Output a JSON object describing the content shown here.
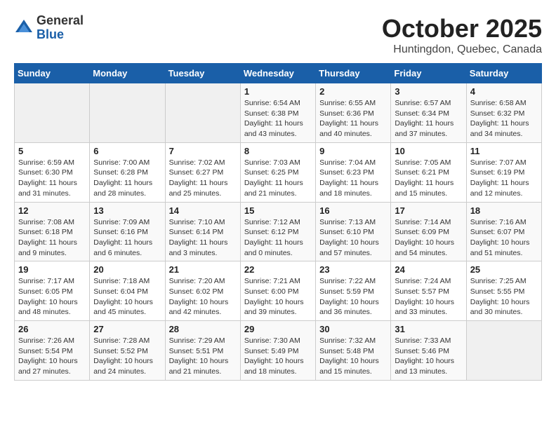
{
  "logo": {
    "general": "General",
    "blue": "Blue"
  },
  "title": "October 2025",
  "location": "Huntingdon, Quebec, Canada",
  "weekdays": [
    "Sunday",
    "Monday",
    "Tuesday",
    "Wednesday",
    "Thursday",
    "Friday",
    "Saturday"
  ],
  "weeks": [
    [
      {
        "day": "",
        "info": ""
      },
      {
        "day": "",
        "info": ""
      },
      {
        "day": "",
        "info": ""
      },
      {
        "day": "1",
        "info": "Sunrise: 6:54 AM\nSunset: 6:38 PM\nDaylight: 11 hours\nand 43 minutes."
      },
      {
        "day": "2",
        "info": "Sunrise: 6:55 AM\nSunset: 6:36 PM\nDaylight: 11 hours\nand 40 minutes."
      },
      {
        "day": "3",
        "info": "Sunrise: 6:57 AM\nSunset: 6:34 PM\nDaylight: 11 hours\nand 37 minutes."
      },
      {
        "day": "4",
        "info": "Sunrise: 6:58 AM\nSunset: 6:32 PM\nDaylight: 11 hours\nand 34 minutes."
      }
    ],
    [
      {
        "day": "5",
        "info": "Sunrise: 6:59 AM\nSunset: 6:30 PM\nDaylight: 11 hours\nand 31 minutes."
      },
      {
        "day": "6",
        "info": "Sunrise: 7:00 AM\nSunset: 6:28 PM\nDaylight: 11 hours\nand 28 minutes."
      },
      {
        "day": "7",
        "info": "Sunrise: 7:02 AM\nSunset: 6:27 PM\nDaylight: 11 hours\nand 25 minutes."
      },
      {
        "day": "8",
        "info": "Sunrise: 7:03 AM\nSunset: 6:25 PM\nDaylight: 11 hours\nand 21 minutes."
      },
      {
        "day": "9",
        "info": "Sunrise: 7:04 AM\nSunset: 6:23 PM\nDaylight: 11 hours\nand 18 minutes."
      },
      {
        "day": "10",
        "info": "Sunrise: 7:05 AM\nSunset: 6:21 PM\nDaylight: 11 hours\nand 15 minutes."
      },
      {
        "day": "11",
        "info": "Sunrise: 7:07 AM\nSunset: 6:19 PM\nDaylight: 11 hours\nand 12 minutes."
      }
    ],
    [
      {
        "day": "12",
        "info": "Sunrise: 7:08 AM\nSunset: 6:18 PM\nDaylight: 11 hours\nand 9 minutes."
      },
      {
        "day": "13",
        "info": "Sunrise: 7:09 AM\nSunset: 6:16 PM\nDaylight: 11 hours\nand 6 minutes."
      },
      {
        "day": "14",
        "info": "Sunrise: 7:10 AM\nSunset: 6:14 PM\nDaylight: 11 hours\nand 3 minutes."
      },
      {
        "day": "15",
        "info": "Sunrise: 7:12 AM\nSunset: 6:12 PM\nDaylight: 11 hours\nand 0 minutes."
      },
      {
        "day": "16",
        "info": "Sunrise: 7:13 AM\nSunset: 6:10 PM\nDaylight: 10 hours\nand 57 minutes."
      },
      {
        "day": "17",
        "info": "Sunrise: 7:14 AM\nSunset: 6:09 PM\nDaylight: 10 hours\nand 54 minutes."
      },
      {
        "day": "18",
        "info": "Sunrise: 7:16 AM\nSunset: 6:07 PM\nDaylight: 10 hours\nand 51 minutes."
      }
    ],
    [
      {
        "day": "19",
        "info": "Sunrise: 7:17 AM\nSunset: 6:05 PM\nDaylight: 10 hours\nand 48 minutes."
      },
      {
        "day": "20",
        "info": "Sunrise: 7:18 AM\nSunset: 6:04 PM\nDaylight: 10 hours\nand 45 minutes."
      },
      {
        "day": "21",
        "info": "Sunrise: 7:20 AM\nSunset: 6:02 PM\nDaylight: 10 hours\nand 42 minutes."
      },
      {
        "day": "22",
        "info": "Sunrise: 7:21 AM\nSunset: 6:00 PM\nDaylight: 10 hours\nand 39 minutes."
      },
      {
        "day": "23",
        "info": "Sunrise: 7:22 AM\nSunset: 5:59 PM\nDaylight: 10 hours\nand 36 minutes."
      },
      {
        "day": "24",
        "info": "Sunrise: 7:24 AM\nSunset: 5:57 PM\nDaylight: 10 hours\nand 33 minutes."
      },
      {
        "day": "25",
        "info": "Sunrise: 7:25 AM\nSunset: 5:55 PM\nDaylight: 10 hours\nand 30 minutes."
      }
    ],
    [
      {
        "day": "26",
        "info": "Sunrise: 7:26 AM\nSunset: 5:54 PM\nDaylight: 10 hours\nand 27 minutes."
      },
      {
        "day": "27",
        "info": "Sunrise: 7:28 AM\nSunset: 5:52 PM\nDaylight: 10 hours\nand 24 minutes."
      },
      {
        "day": "28",
        "info": "Sunrise: 7:29 AM\nSunset: 5:51 PM\nDaylight: 10 hours\nand 21 minutes."
      },
      {
        "day": "29",
        "info": "Sunrise: 7:30 AM\nSunset: 5:49 PM\nDaylight: 10 hours\nand 18 minutes."
      },
      {
        "day": "30",
        "info": "Sunrise: 7:32 AM\nSunset: 5:48 PM\nDaylight: 10 hours\nand 15 minutes."
      },
      {
        "day": "31",
        "info": "Sunrise: 7:33 AM\nSunset: 5:46 PM\nDaylight: 10 hours\nand 13 minutes."
      },
      {
        "day": "",
        "info": ""
      }
    ]
  ]
}
